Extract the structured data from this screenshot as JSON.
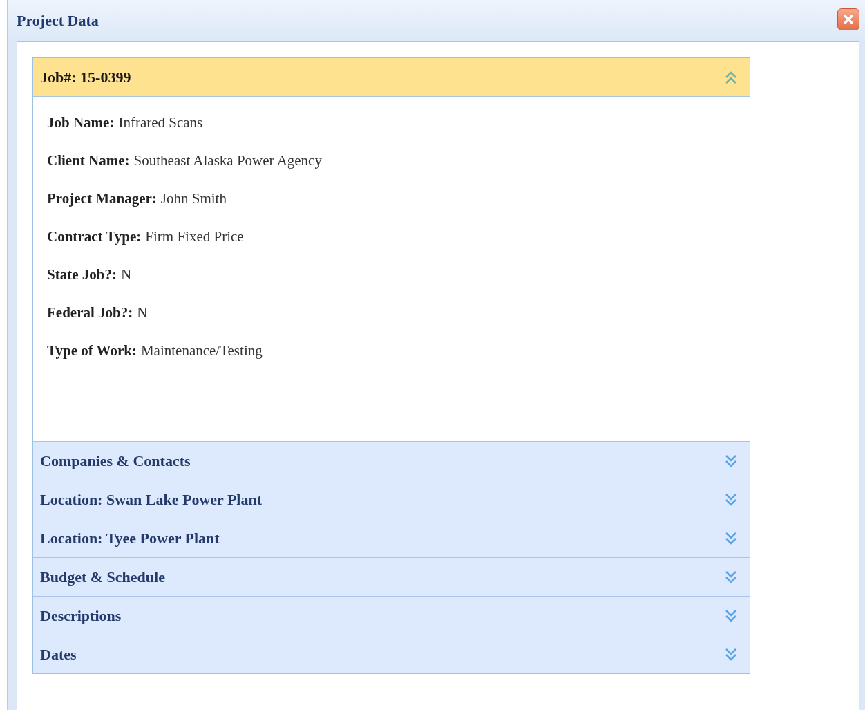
{
  "window": {
    "title": "Project Data"
  },
  "sections": [
    {
      "title": "Job#: 15-0399",
      "expanded": true,
      "fields": [
        {
          "label": "Job Name:",
          "value": "Infrared Scans"
        },
        {
          "label": "Client Name:",
          "value": "Southeast Alaska Power Agency"
        },
        {
          "label": "Project Manager:",
          "value": "John Smith"
        },
        {
          "label": "Contract Type:",
          "value": "Firm Fixed Price"
        },
        {
          "label": "State Job?:",
          "value": "N"
        },
        {
          "label": "Federal Job?:",
          "value": "N"
        },
        {
          "label": "Type of Work:",
          "value": "Maintenance/Testing"
        }
      ]
    },
    {
      "title": "Companies & Contacts",
      "expanded": false
    },
    {
      "title": "Location: Swan Lake Power Plant",
      "expanded": false
    },
    {
      "title": "Location: Tyee Power Plant",
      "expanded": false
    },
    {
      "title": "Budget & Schedule",
      "expanded": false
    },
    {
      "title": "Descriptions",
      "expanded": false
    },
    {
      "title": "Dates",
      "expanded": false
    }
  ]
}
